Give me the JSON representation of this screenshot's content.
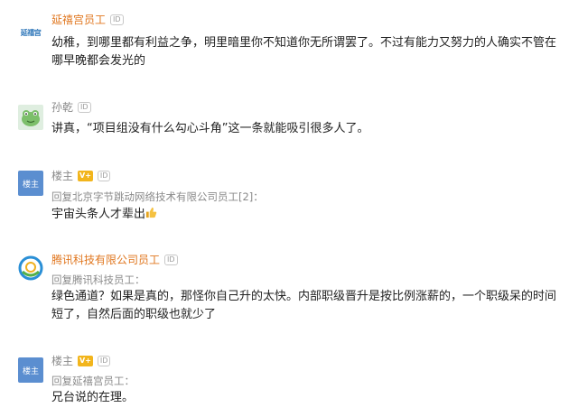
{
  "comments": [
    {
      "avatar_text": "延禧宫",
      "name": "延禧宫员工",
      "id_badge": "ID",
      "text": "幼稚，到哪里都有利益之争，明里暗里你不知道你无所谓罢了。不过有能力又努力的人确实不管在哪早晚都会发光的"
    },
    {
      "name": "孙乾",
      "id_badge": "ID",
      "text": "讲真，“项目组没有什么勾心斗角”这一条就能吸引很多人了。"
    },
    {
      "avatar_text": "楼主",
      "name": "楼主",
      "v_badge": "V+",
      "id_badge": "ID",
      "reply_to": "回复北京字节跳动网络技术有限公司员工[2]：",
      "text": "宇宙头条人才辈出",
      "emoji": "thumbs-up-icon"
    },
    {
      "name": "腾讯科技有限公司员工",
      "id_badge": "ID",
      "reply_to": "回复腾讯科技员工：",
      "text": "绿色通道？如果是真的，那怪你自己升的太快。内部职级晋升是按比例涨薪的，一个职级呆的时间短了，自然后面的职级也就少了"
    },
    {
      "avatar_text": "楼主",
      "name": "楼主",
      "v_badge": "V+",
      "id_badge": "ID",
      "reply_to": "回复延禧宫员工：",
      "text": "兄台说的在理。"
    }
  ],
  "colors": {
    "org_name": "#e0761e",
    "user_name": "#8a8a8a",
    "op_avatar": "#5b8ed0",
    "v_badge": "#f2b51c"
  }
}
